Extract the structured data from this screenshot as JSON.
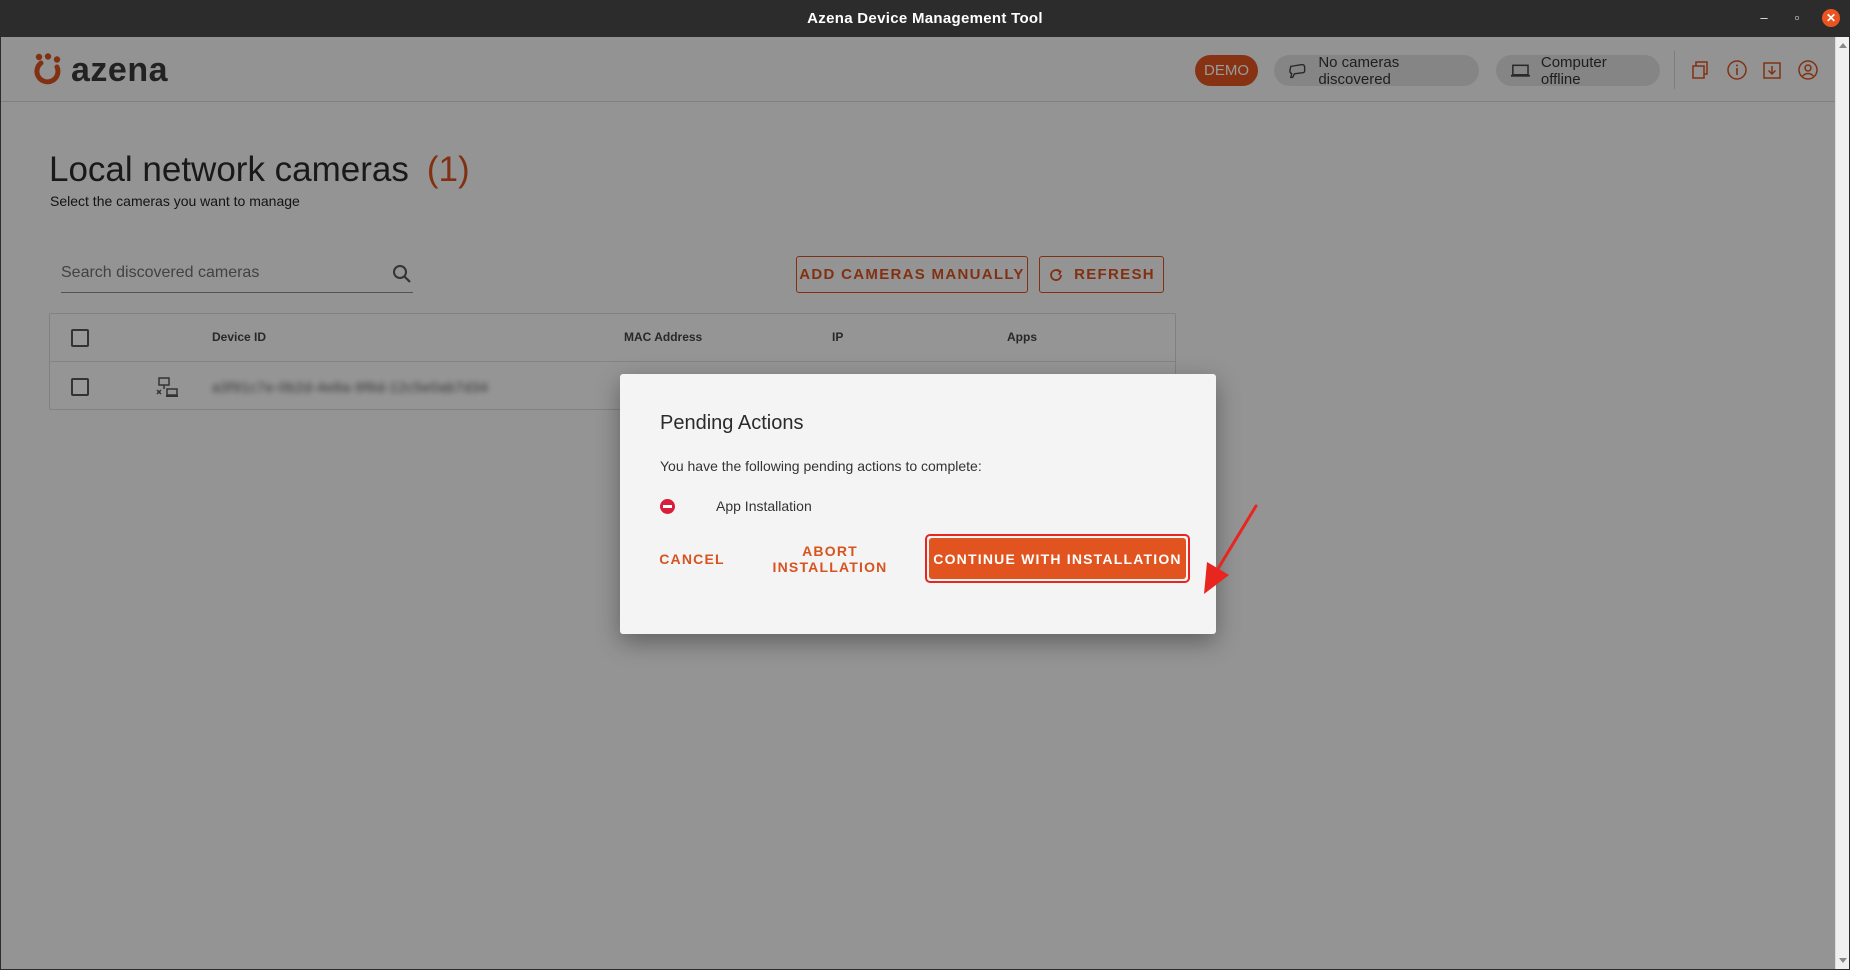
{
  "window": {
    "title": "Azena Device Management Tool",
    "minimize": "–",
    "maximize": "▫",
    "close": "✕"
  },
  "header": {
    "logo_text": "azena",
    "demo_label": "DEMO",
    "cameras_status": "No cameras discovered",
    "computer_status": "Computer offline",
    "icons": [
      "devices-icon",
      "info-icon",
      "upload-icon",
      "account-icon"
    ]
  },
  "main": {
    "title": "Local network cameras",
    "count": "(1)",
    "subtitle": "Select the cameras you want to manage",
    "search": {
      "placeholder": "Search discovered cameras",
      "value": ""
    },
    "add_button": "ADD CAMERAS MANUALLY",
    "refresh_button": "REFRESH",
    "table": {
      "columns": [
        "Device ID",
        "MAC Address",
        "IP",
        "Apps"
      ],
      "rows": [
        {
          "device_id": "a3f91c7e-0b2d-4e8a-9f6d-12c5e0ab7d34"
        }
      ]
    }
  },
  "dialog": {
    "title": "Pending Actions",
    "message": "You have the following pending actions to complete:",
    "items": [
      "App Installation"
    ],
    "cancel": "CANCEL",
    "abort": "ABORT INSTALLATION",
    "continue": "CONTINUE WITH INSTALLATION"
  },
  "colors": {
    "accent": "#d7531f",
    "primary_button": "#e2541f",
    "remove_icon": "#d81e3b",
    "annotation": "#e8251e",
    "titlebar": "#2c2c2c"
  }
}
